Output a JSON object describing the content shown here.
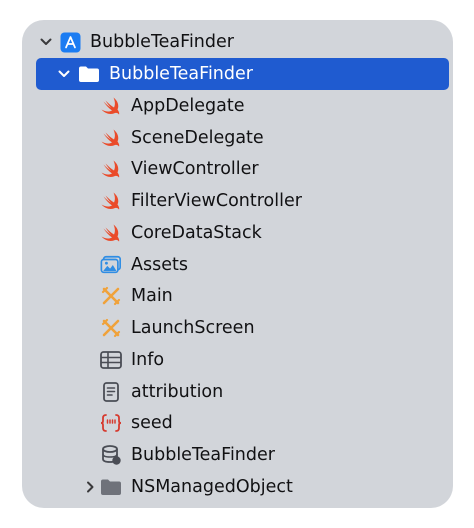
{
  "navigator": {
    "project": {
      "name": "BubbleTeaFinder",
      "icon": "xcode-project-icon",
      "expanded": true
    },
    "group": {
      "name": "BubbleTeaFinder",
      "icon": "folder-icon",
      "expanded": true,
      "selected": true
    },
    "files": [
      {
        "name": "AppDelegate",
        "icon": "swift-icon"
      },
      {
        "name": "SceneDelegate",
        "icon": "swift-icon"
      },
      {
        "name": "ViewController",
        "icon": "swift-icon"
      },
      {
        "name": "FilterViewController",
        "icon": "swift-icon"
      },
      {
        "name": "CoreDataStack",
        "icon": "swift-icon"
      },
      {
        "name": "Assets",
        "icon": "asset-catalog-icon"
      },
      {
        "name": "Main",
        "icon": "storyboard-icon"
      },
      {
        "name": "LaunchScreen",
        "icon": "storyboard-icon"
      },
      {
        "name": "Info",
        "icon": "plist-table-icon"
      },
      {
        "name": "attribution",
        "icon": "text-file-icon"
      },
      {
        "name": "seed",
        "icon": "json-file-icon"
      },
      {
        "name": "BubbleTeaFinder",
        "icon": "core-data-model-icon"
      }
    ],
    "subgroup": {
      "name": "NSManagedObject",
      "icon": "folder-icon",
      "expanded": false
    }
  },
  "colors": {
    "selection": "#1f5bd0",
    "panel": "#d2d5da",
    "swift": "#ea4b2a",
    "asset": "#2f8de4",
    "storyboard": "#f0a23a",
    "json": "#d63a2f",
    "folder": "#7b7e85"
  }
}
